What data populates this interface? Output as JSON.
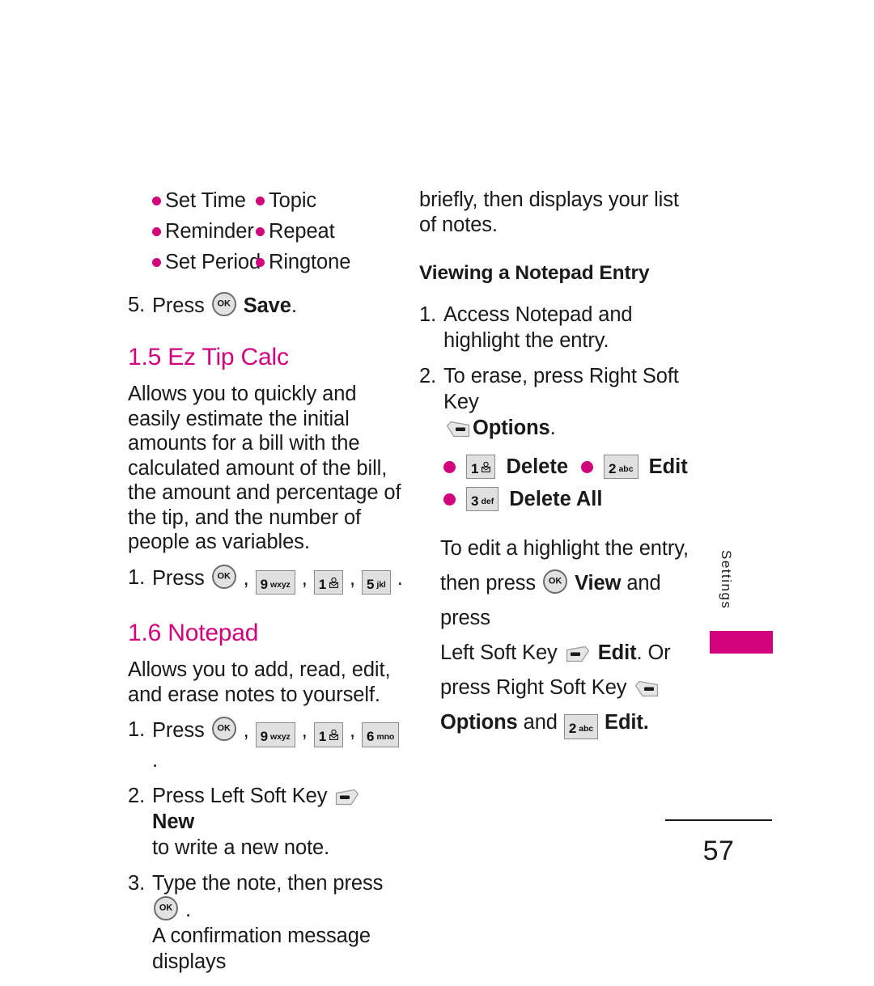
{
  "colors": {
    "accent": "#D2017C",
    "text": "#1A1A1A",
    "key_fill": "#E0E0E0",
    "key_border": "#8A8A8A"
  },
  "left_column": {
    "bullets": [
      {
        "label": "Set Time"
      },
      {
        "label": "Topic"
      },
      {
        "label": "Reminder"
      },
      {
        "label": "Repeat"
      },
      {
        "label": "Set Period"
      },
      {
        "label": "Ringtone"
      }
    ],
    "step5": {
      "num": "5.",
      "text_before": "Press",
      "key": "OK",
      "bold_label": "Save",
      "period": "."
    },
    "section_1_5": {
      "heading": "1.5 Ez Tip Calc",
      "body": "Allows you to quickly and easily estimate the initial amounts for a bill with the calculated amount of the bill, the amount and percentage of the tip, and the number of people as variables.",
      "step1": {
        "num": "1.",
        "text_before": "Press",
        "keys": [
          {
            "digit": "9",
            "sub": "wxyz"
          },
          {
            "digit": "1",
            "sub": "envelope-icon"
          },
          {
            "digit": "5",
            "sub": "jkl"
          }
        ],
        "period": "."
      }
    },
    "section_1_6": {
      "heading": "1.6 Notepad",
      "body": "Allows you to add, read, edit, and erase notes to yourself.",
      "step1": {
        "num": "1.",
        "text_before": "Press",
        "keys": [
          {
            "digit": "9",
            "sub": "wxyz"
          },
          {
            "digit": "1",
            "sub": "envelope-icon"
          },
          {
            "digit": "6",
            "sub": "mno"
          }
        ],
        "period": "."
      },
      "step2": {
        "num": "2.",
        "text_before": "Press Left Soft Key",
        "softkey": "left-soft-key",
        "bold_label": "New",
        "text_after": "to write a new note."
      },
      "step3": {
        "num": "3.",
        "text_before": "Type the note, then press",
        "key": "OK",
        "period": ".",
        "text_after": "A confirmation message displays"
      }
    }
  },
  "right_column": {
    "continued_text": "briefly, then displays your list of notes.",
    "subheading": "Viewing a Notepad Entry",
    "step1": {
      "num": "1.",
      "text": "Access Notepad and highlight the entry."
    },
    "step2": {
      "num": "2.",
      "text_before": "To erase, press Right Soft Key",
      "softkey": "right-soft-key",
      "bold_label": "Options",
      "period": "."
    },
    "options": [
      {
        "digit": "1",
        "sub": "envelope-icon",
        "label": "Delete"
      },
      {
        "digit": "2",
        "sub": "abc",
        "label": "Edit"
      },
      {
        "digit": "3",
        "sub": "def",
        "label": "Delete All"
      }
    ],
    "closing": {
      "line1": "To edit a highlight the entry,",
      "line2_a": "then press",
      "line2_key": "OK",
      "line2_bold": "View",
      "line2_b": "and press",
      "line3_a": "Left Soft Key",
      "line3_softkey": "left-soft-key",
      "line3_bold": "Edit",
      "line3_b": ". Or",
      "line4_a": "press Right Soft Key",
      "line4_softkey": "right-soft-key",
      "line5_bold_a": "Options",
      "line5_and": "and",
      "line5_key": {
        "digit": "2",
        "sub": "abc"
      },
      "line5_bold_b": "Edit."
    }
  },
  "side_tab": {
    "label": "Settings"
  },
  "footer": {
    "page_number": "57"
  }
}
